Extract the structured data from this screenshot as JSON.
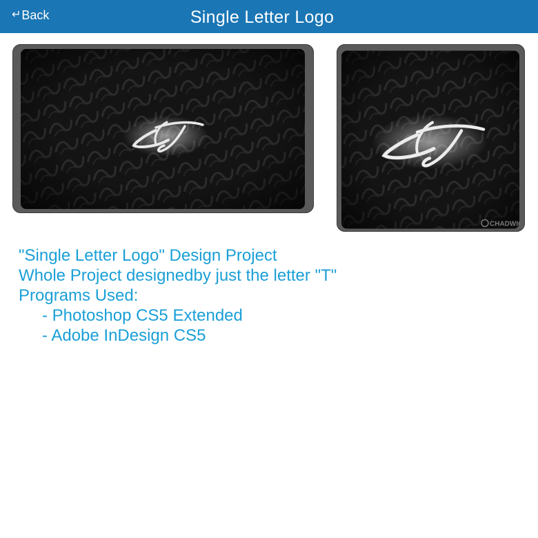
{
  "header": {
    "back_icon": "↵",
    "back_label": "Back",
    "title": "Single Letter Logo"
  },
  "images": [
    {
      "name": "logo-wide-mockup",
      "icon": "lt-monogram-logo"
    },
    {
      "name": "logo-square-mockup",
      "icon": "lt-monogram-logo",
      "watermark": "CHADWICK"
    }
  ],
  "description": {
    "line1": "\"Single Letter Logo\" Design Project",
    "line2": "Whole Project designedby just the letter \"T\"",
    "line3": "Programs Used:",
    "line4": "- Photoshop CS5 Extended",
    "line5": "- Adobe InDesign CS5"
  },
  "colors": {
    "header_bg": "#1a76b5",
    "text_accent": "#1a9fd6",
    "frame": "#5a5a5a"
  }
}
